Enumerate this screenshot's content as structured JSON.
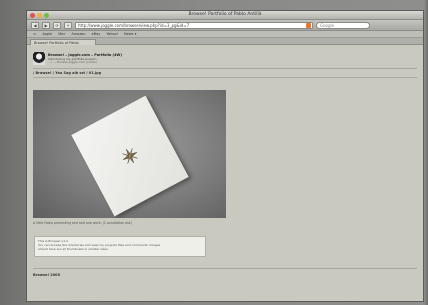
{
  "window": {
    "title": "Browse! Portfolio of Pablo Antillà",
    "url": "http://www.joggle.com/browse/view.php?id=3_pg&id=7",
    "search_placeholder": "Google"
  },
  "toolbar": {
    "back_label": "◀",
    "forward_label": "▶",
    "reload_label": "⟳",
    "add_label": "+"
  },
  "bookmarks": [
    "Apple",
    "Mac",
    "Amazon",
    "eBay",
    "Yahoo!",
    "News ▾"
  ],
  "tab": {
    "label": "Browse! Portfolio of Pablo"
  },
  "site": {
    "title": "Browse! – Joggle.com – Portfolio (4W)",
    "subtitle": "Introducing my portfolio project...",
    "meta": "…/ — Browse.joggle.com posted"
  },
  "breadcrumb": "/ Browse! / Yao Sag alb sel / 01.jpg",
  "photo_caption": "A little Pablo presenting one and one work. (1 annotation ask)",
  "note": {
    "title": "This is Browse! v1.2",
    "line1": "You can browse the directories and view my projects files and comments. Images",
    "line2": "should here are all thumbnails in smaller sizes."
  },
  "footer": "Browse! 2005",
  "colors": {
    "window_bg": "#c9c9c0",
    "accent_feed": "#e9742a"
  }
}
